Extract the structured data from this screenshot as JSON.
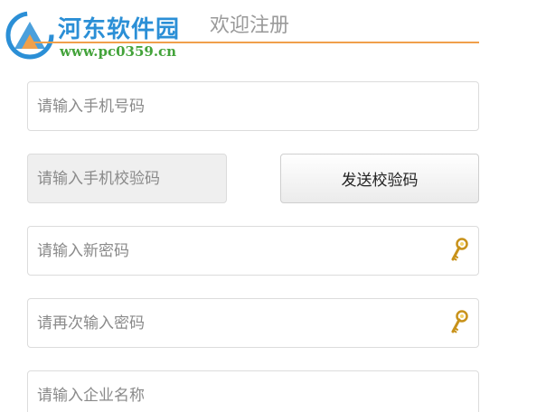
{
  "watermark": {
    "name": "河东软件园",
    "url": "www.pc0359.cn"
  },
  "header": {
    "title": "欢迎注册"
  },
  "form": {
    "phone": {
      "placeholder": "请输入手机号码",
      "value": ""
    },
    "code": {
      "placeholder": "请输入手机校验码",
      "value": ""
    },
    "send_code_label": "发送校验码",
    "new_password": {
      "placeholder": "请输入新密码",
      "value": "",
      "icon": "key-icon"
    },
    "confirm_password": {
      "placeholder": "请再次输入密码",
      "value": "",
      "icon": "key-icon"
    },
    "company": {
      "placeholder": "请输入企业名称",
      "value": ""
    }
  },
  "colors": {
    "accent_line": "#f0a04b",
    "title_text": "#9a9a9a",
    "watermark_blue": "#2b8fd6",
    "watermark_green": "#43a33a",
    "key_gold": "#d4a017"
  }
}
